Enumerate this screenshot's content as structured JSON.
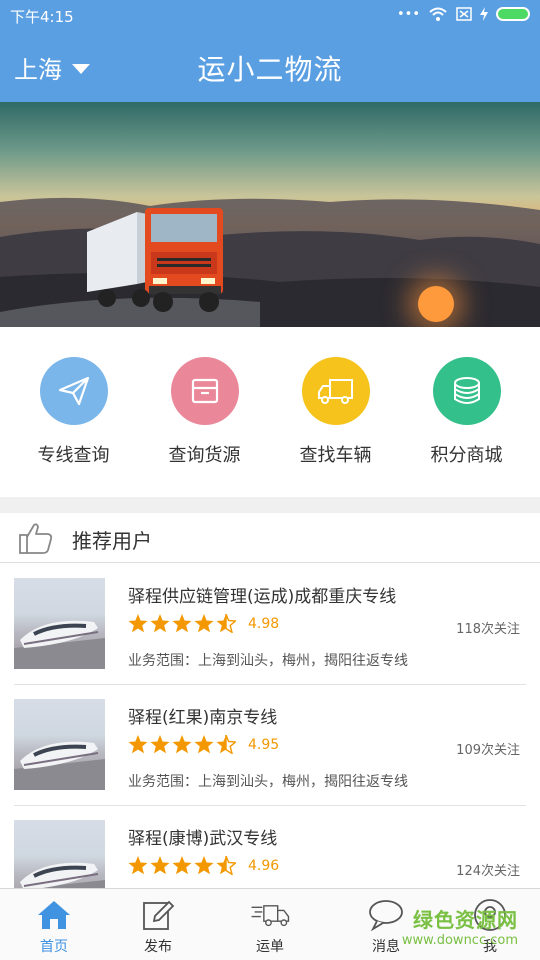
{
  "status_bar": {
    "time": "下午4:15",
    "more": "•••"
  },
  "header": {
    "city": "上海",
    "title": "运小二物流"
  },
  "quick_menu": [
    {
      "label": "专线查询",
      "icon": "paper-plane-icon",
      "color": "#7ab6ea"
    },
    {
      "label": "查询货源",
      "icon": "box-icon",
      "color": "#ea8799"
    },
    {
      "label": "查找车辆",
      "icon": "truck-icon",
      "color": "#f5c31c"
    },
    {
      "label": "积分商城",
      "icon": "coins-stack-icon",
      "color": "#34c08a"
    }
  ],
  "recommend": {
    "title": "推荐用户",
    "items": [
      {
        "name": "驿程供应链管理(运成)成都重庆专线",
        "rating": "4.98",
        "follows": "118次关注",
        "scope": "业务范围：上海到汕头，梅州，揭阳往返专线"
      },
      {
        "name": "驿程(红果)南京专线",
        "rating": "4.95",
        "follows": "109次关注",
        "scope": "业务范围：上海到汕头，梅州，揭阳往返专线"
      },
      {
        "name": "驿程(康博)武汉专线",
        "rating": "4.96",
        "follows": "124次关注",
        "scope": ""
      }
    ]
  },
  "bottom_nav": [
    {
      "label": "首页",
      "icon": "home-icon",
      "active": true
    },
    {
      "label": "发布",
      "icon": "edit-icon",
      "active": false
    },
    {
      "label": "运单",
      "icon": "delivery-truck-icon",
      "active": false
    },
    {
      "label": "消息",
      "icon": "chat-bubble-icon",
      "active": false
    },
    {
      "label": "我",
      "icon": "user-icon",
      "active": false
    }
  ],
  "watermark": {
    "line1": "绿色资源网",
    "line2": "www.downcc.com"
  },
  "colors": {
    "primary": "#5b9fe3",
    "star": "#f39800",
    "active_tab": "#3f93e1"
  },
  "banner": {
    "slides": 3,
    "active_slide": 1
  }
}
